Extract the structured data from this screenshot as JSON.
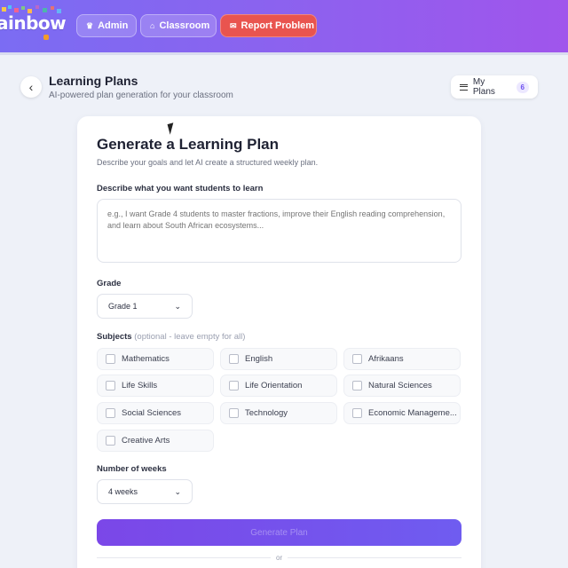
{
  "nav": {
    "logo": "ainbow",
    "admin": {
      "icon": "admin-icon",
      "label": "Admin"
    },
    "classroom": {
      "icon": "school-icon",
      "label": "Classroom"
    },
    "report": {
      "icon": "report-icon",
      "label": "Report Problem"
    }
  },
  "header": {
    "title": "Learning Plans",
    "subtitle": "AI-powered plan generation for your classroom",
    "my_plans_label": "My Plans",
    "my_plans_count": "6"
  },
  "form": {
    "title": "Generate a Learning Plan",
    "subtitle": "Describe your goals and let AI create a structured weekly plan.",
    "describe_label": "Describe what you want students to learn",
    "describe_placeholder": "e.g., I want Grade 4 students to master fractions, improve their English reading comprehension, and learn about South African ecosystems...",
    "grade_label": "Grade",
    "grade_value": "Grade 1",
    "subjects_label": "Subjects",
    "subjects_hint": "(optional - leave empty for all)",
    "subjects": [
      "Mathematics",
      "English",
      "Afrikaans",
      "Life Skills",
      "Life Orientation",
      "Natural Sciences",
      "Social Sciences",
      "Technology",
      "Economic Manageme...",
      "Creative Arts"
    ],
    "weeks_label": "Number of weeks",
    "weeks_value": "4 weeks",
    "generate_label": "Generate Plan",
    "divider_text": "or"
  },
  "colors": {
    "accent": "#7b47e8",
    "report": "#e9544f",
    "nav_gradient_start": "#7b6cf3",
    "nav_gradient_end": "#a055ec"
  }
}
